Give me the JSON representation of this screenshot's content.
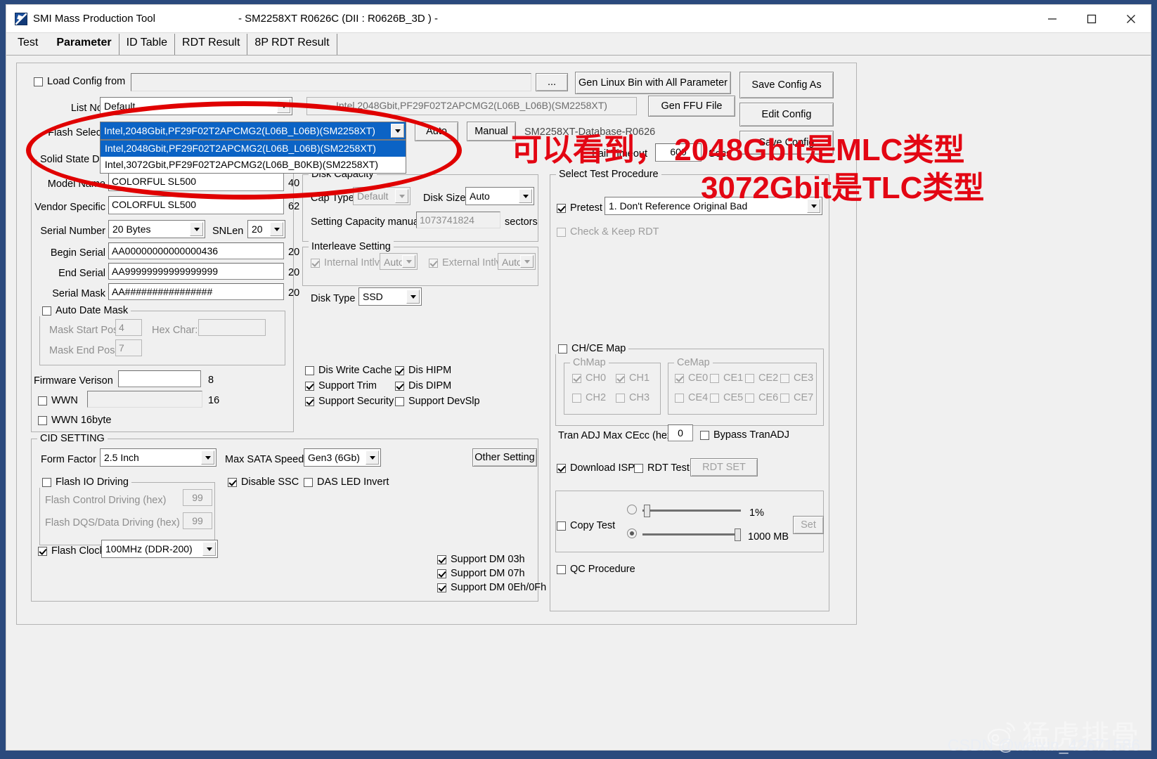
{
  "window": {
    "title": "SMI Mass Production Tool",
    "subtitle": "- SM2258XT   R0626C    (DII : R0626B_3D ) -",
    "minimize": "─",
    "maximize": "☐",
    "close": "✕"
  },
  "tabs": [
    {
      "label": "Test",
      "active": false
    },
    {
      "label": "Parameter",
      "active": true
    },
    {
      "label": "ID Table",
      "active": false
    },
    {
      "label": "RDT Result",
      "active": false
    },
    {
      "label": "8P RDT Result",
      "active": false
    }
  ],
  "top": {
    "load_config_label": "Load Config from",
    "load_config_checked": false,
    "load_config_value": "",
    "browse_label": "...",
    "gen_linux_bin": "Gen Linux Bin with All Parameter",
    "save_config_as": "Save Config As",
    "gen_ffu_file": "Gen FFU File",
    "edit_config": "Edit Config",
    "save_config": "Save Config",
    "list_no_label": "List No.",
    "list_no_value": "Default",
    "list_no_right_text": "Intel,2048Gbit,PF29F02T2APCMG2(L06B_L06B)(SM2258XT)",
    "flash_select_label": "Flash Select",
    "flash_select_value": "Intel,2048Gbit,PF29F02T2APCMG2(L06B_L06B)(SM2258XT)",
    "auto_button": "Auto",
    "manual_button": "Manual",
    "database_label": "SM2258XT-Database-R0626",
    "fail_timeout_label": "Fail Timeout",
    "fail_timeout_value": "600",
    "secs_label": "Secs",
    "dropdown_options": [
      {
        "label": "Intel,2048Gbit,PF29F02T2APCMG2(L06B_L06B)(SM2258XT)",
        "selected": true
      },
      {
        "label": "Intel,3072Gbit,PF29F02T2APCMG2(L06B_B0KB)(SM2258XT)",
        "selected": false
      }
    ]
  },
  "ssd_group": {
    "title": "Solid State Disk",
    "model_name_label": "Model Name",
    "model_name_value": "COLORFUL SL500",
    "model_name_len": "40",
    "vendor_specific_label": "Vendor Specific",
    "vendor_specific_value": "COLORFUL SL500",
    "vendor_specific_len": "62",
    "serial_number_label": "Serial Number",
    "serial_number_value": "20 Bytes",
    "snlen_label": "SNLen",
    "snlen_value": "20",
    "begin_serial_label": "Begin Serial",
    "begin_serial_value": "AA00000000000000436",
    "begin_serial_len": "20",
    "end_serial_label": "End Serial",
    "end_serial_value": "AA99999999999999999",
    "end_serial_len": "20",
    "serial_mask_label": "Serial Mask",
    "serial_mask_value": "AA################",
    "serial_mask_len": "20"
  },
  "auto_date_mask": {
    "title": "Auto Date Mask",
    "checked": false,
    "mask_start_pos_label": "Mask Start Pos",
    "mask_start_pos_value": "4",
    "mask_end_pos_label": "Mask End Pos",
    "mask_end_pos_value": "7",
    "hex_char_label": "Hex Char:",
    "hex_char_value": ""
  },
  "firmware": {
    "fw_version_label": "Firmware Verison",
    "fw_version_value": "",
    "fw_version_len": "8",
    "wwn_label": "WWN",
    "wwn_checked": false,
    "wwn_value": "",
    "wwn_len": "16",
    "wwn16_label": "WWN 16byte",
    "wwn16_checked": false
  },
  "disk_capacity": {
    "title": "Disk Capacity",
    "cap_type_label": "Cap Type",
    "cap_type_value": "Default",
    "disk_size_label": "Disk Size",
    "disk_size_value": "Auto",
    "setting_capacity_label": "Setting Capacity manually",
    "setting_capacity_value": "1073741824",
    "sectors_label": "sectors"
  },
  "interleave": {
    "title": "Interleave Setting",
    "internal_label": "Internal Intlv",
    "internal_checked": true,
    "internal_value": "Auto",
    "external_label": "External Intlv",
    "external_checked": true,
    "external_value": "Auto"
  },
  "disk_type": {
    "label": "Disk Type",
    "value": "SSD"
  },
  "feature_checks": [
    {
      "label": "Dis Write Cache",
      "checked": false
    },
    {
      "label": "Dis HIPM",
      "checked": true
    },
    {
      "label": "Support Trim",
      "checked": true
    },
    {
      "label": "Dis DIPM",
      "checked": true
    },
    {
      "label": "Support Security",
      "checked": true
    },
    {
      "label": "Support DevSlp",
      "checked": false
    }
  ],
  "cid_setting": {
    "title": "CID SETTING",
    "form_factor_label": "Form Factor",
    "form_factor_value": "2.5 Inch",
    "max_sata_speed_label": "Max SATA Speed",
    "max_sata_speed_value": "Gen3 (6Gb)",
    "other_setting_button": "Other Setting",
    "disable_ssc_label": "Disable SSC",
    "disable_ssc_checked": true,
    "das_led_invert_label": "DAS LED Invert",
    "das_led_invert_checked": false,
    "flash_io_driving_title": "Flash IO Driving",
    "flash_io_driving_checked": false,
    "flash_control_driving_label": "Flash Control Driving (hex)",
    "flash_control_driving_value": "99",
    "flash_dqs_driving_label": "Flash DQS/Data Driving (hex)",
    "flash_dqs_driving_value": "99",
    "flash_clock_label": "Flash Clock",
    "flash_clock_checked": true,
    "flash_clock_value": "100MHz (DDR-200)"
  },
  "support_dm": [
    {
      "label": "Support DM 03h",
      "checked": true
    },
    {
      "label": "Support DM 07h",
      "checked": true
    },
    {
      "label": "Support DM 0Eh/0Fh",
      "checked": true
    }
  ],
  "test_procedure": {
    "title": "Select Test Procedure",
    "pretest_label": "Pretest",
    "pretest_checked": true,
    "pretest_value": "1. Don't Reference Original Bad",
    "check_keep_rdt_label": "Check & Keep RDT",
    "check_keep_rdt_checked": false
  },
  "chce_map": {
    "title": "CH/CE Map",
    "checked": false,
    "chmap_title": "ChMap",
    "chmap": [
      {
        "label": "CH0",
        "checked": true
      },
      {
        "label": "CH1",
        "checked": true
      },
      {
        "label": "CH2",
        "checked": false
      },
      {
        "label": "CH3",
        "checked": false
      }
    ],
    "cemap_title": "CeMap",
    "cemap": [
      {
        "label": "CE0",
        "checked": true
      },
      {
        "label": "CE1",
        "checked": false
      },
      {
        "label": "CE2",
        "checked": false
      },
      {
        "label": "CE3",
        "checked": false
      },
      {
        "label": "CE4",
        "checked": false
      },
      {
        "label": "CE5",
        "checked": false
      },
      {
        "label": "CE6",
        "checked": false
      },
      {
        "label": "CE7",
        "checked": false
      }
    ],
    "tran_adj_label": "Tran ADJ Max CEcc (hex)",
    "tran_adj_value": "0",
    "bypass_tranadj_label": "Bypass TranADJ",
    "bypass_tranadj_checked": false,
    "download_isp_label": "Download ISP",
    "download_isp_checked": true,
    "rdt_test_label": "RDT Test",
    "rdt_test_checked": false,
    "rdt_set_button": "RDT SET"
  },
  "copy_test": {
    "label": "Copy Test",
    "checked": false,
    "percent_value": "1%",
    "percent_selected": false,
    "size_value": "1000 MB",
    "size_selected": true,
    "set_button": "Set"
  },
  "qc_procedure": {
    "label": "QC Procedure",
    "checked": false
  },
  "annotation": {
    "line1": "可以看到， 2048Gbit是MLC类型",
    "line2": "3072Gbit是TLC类型",
    "color": "#e30613"
  },
  "watermark": {
    "brand": "猛虎排骨",
    "credit": "CSDN @weixin_42671586"
  }
}
